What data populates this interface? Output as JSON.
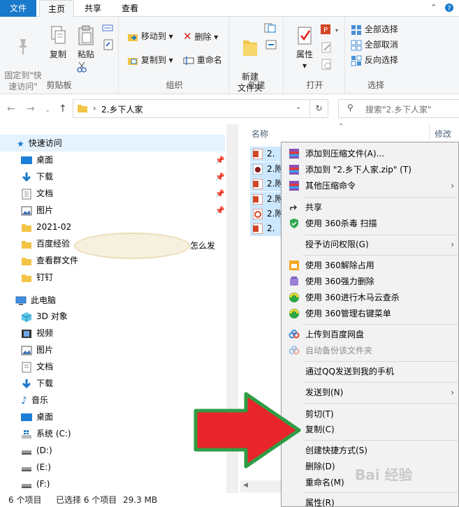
{
  "tabs": {
    "file": "文件",
    "home": "主页",
    "share": "共享",
    "view": "查看"
  },
  "ribbon": {
    "clipboard": {
      "pin": "固定到\"快\n速访问\"",
      "copy": "复制",
      "paste": "粘贴",
      "label": "剪贴板"
    },
    "organize": {
      "move_to": "移动到",
      "copy_to": "复制到",
      "delete": "删除",
      "rename": "重命名",
      "label": "组织"
    },
    "new": {
      "new_folder": "新建\n文件夹",
      "label": "新建"
    },
    "open": {
      "properties": "属性",
      "label": "打开"
    },
    "select": {
      "select_all": "全部选择",
      "select_none": "全部取消",
      "invert": "反向选择",
      "label": "选择"
    }
  },
  "address": {
    "path": "2.乡下人家",
    "search_placeholder": "搜索\"2.乡下人家\""
  },
  "nav": {
    "quick_access": "快速访问",
    "desktop": "桌面",
    "downloads": "下载",
    "documents": "文档",
    "pictures": "图片",
    "folder_2021": "2021-02",
    "baidu": "百度经验",
    "baidu_trail": "怎么发",
    "group_files": "查看群文件",
    "dingding": "钉钉",
    "this_pc": "此电脑",
    "objects3d": "3D 对象",
    "videos": "视频",
    "pictures2": "图片",
    "documents2": "文档",
    "downloads2": "下载",
    "music": "音乐",
    "desktop2": "桌面",
    "drive_c": "系统 (C:)",
    "drive_d": "(D:)",
    "drive_e": "(E:)",
    "drive_f": "(F:)"
  },
  "files": {
    "col_name": "名称",
    "col_modified": "修改日",
    "rows": [
      "2. 乡",
      "2.附",
      "2.附",
      "2.附",
      "2.附",
      "2."
    ]
  },
  "status": {
    "count": "6 个项目",
    "selected": "已选择 6 个项目",
    "size": "29.3 MB"
  },
  "menu": {
    "add_archive": "添加到压缩文件(A)...",
    "add_zip": "添加到 \"2.乡下人家.zip\" (T)",
    "other_compress": "其他压缩命令",
    "share": "共享",
    "scan360": "使用 360杀毒 扫描",
    "grant_access": "授予访问权限(G)",
    "unlock360": "使用 360解除占用",
    "force_delete": "使用 360强力删除",
    "trojan_scan": "使用 360进行木马云查杀",
    "manage_menu": "使用 360管理右键菜单",
    "upload_baidu": "上传到百度网盘",
    "auto_backup": "自动备份该文件夹",
    "send_qq": "通过QQ发送到我的手机",
    "send_to": "发送到(N)",
    "cut": "剪切(T)",
    "copy": "复制(C)",
    "create_shortcut": "创建快捷方式(S)",
    "delete": "删除(D)",
    "rename": "重命名(M)",
    "properties": "属性(R)"
  },
  "watermark": "Bai 经验",
  "colors": {
    "file_tab": "#1979ca",
    "selection": "#cce8ff",
    "arrow_fill": "#e8252a",
    "arrow_border": "#2f9d45"
  }
}
